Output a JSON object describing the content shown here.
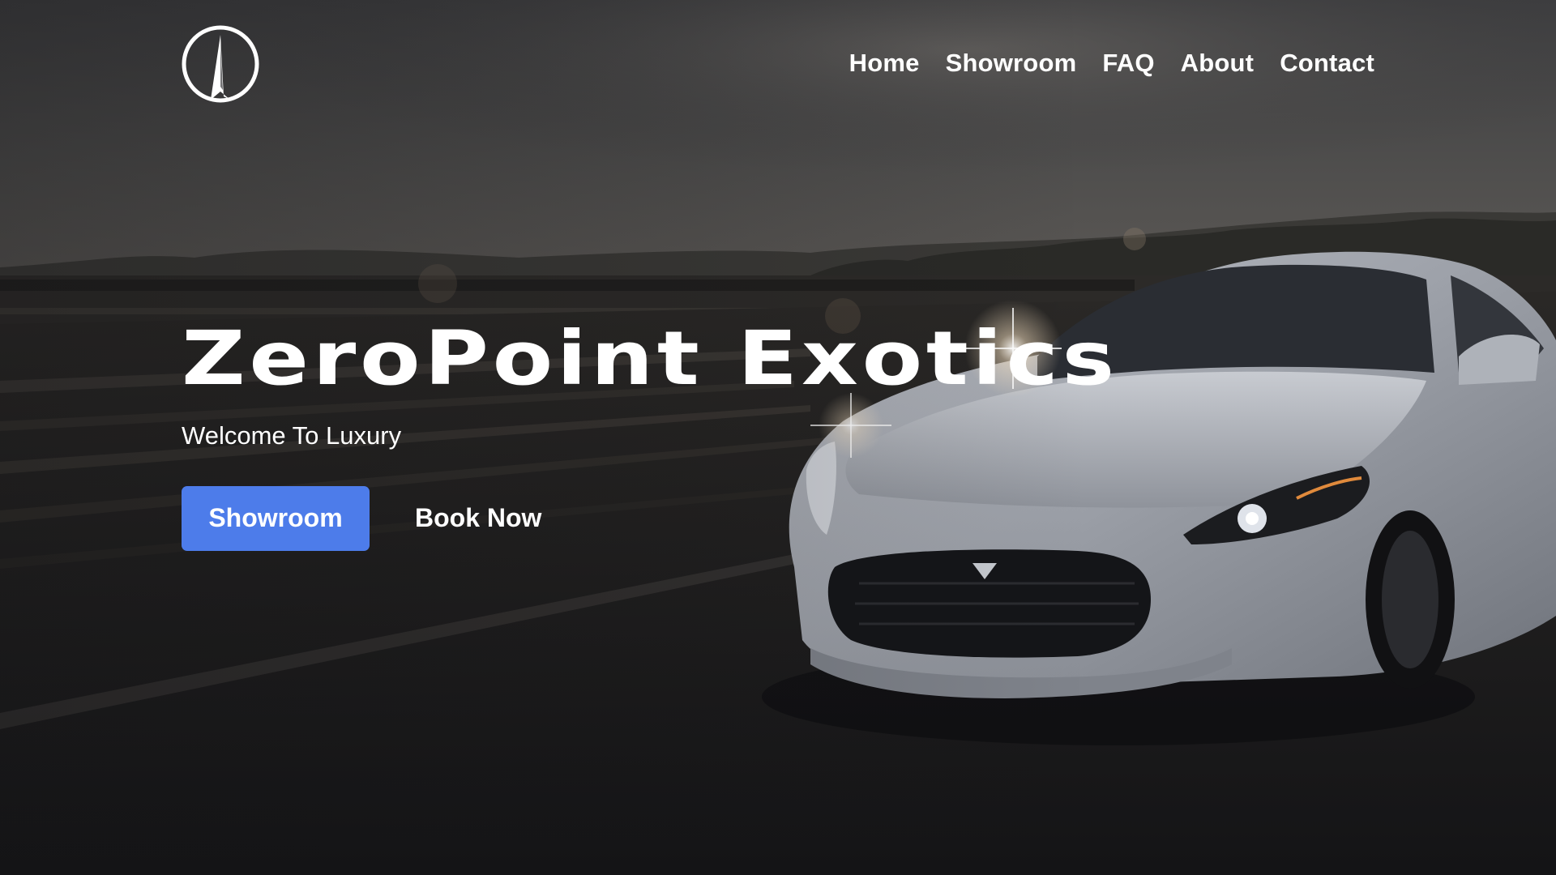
{
  "brand": {
    "logo_icon": "compass-needle-logo-icon"
  },
  "nav": {
    "items": [
      {
        "label": "Home"
      },
      {
        "label": "Showroom"
      },
      {
        "label": "FAQ"
      },
      {
        "label": "About"
      },
      {
        "label": "Contact"
      }
    ]
  },
  "hero": {
    "title": "ZeroPoint Exotics",
    "subtitle": "Welcome To Luxury",
    "primary_button": "Showroom",
    "secondary_button": "Book Now",
    "background_image": "silver-sports-car-on-highway",
    "colors": {
      "accent": "#4d7cea",
      "text": "#ffffff",
      "background": "#17171a"
    }
  }
}
